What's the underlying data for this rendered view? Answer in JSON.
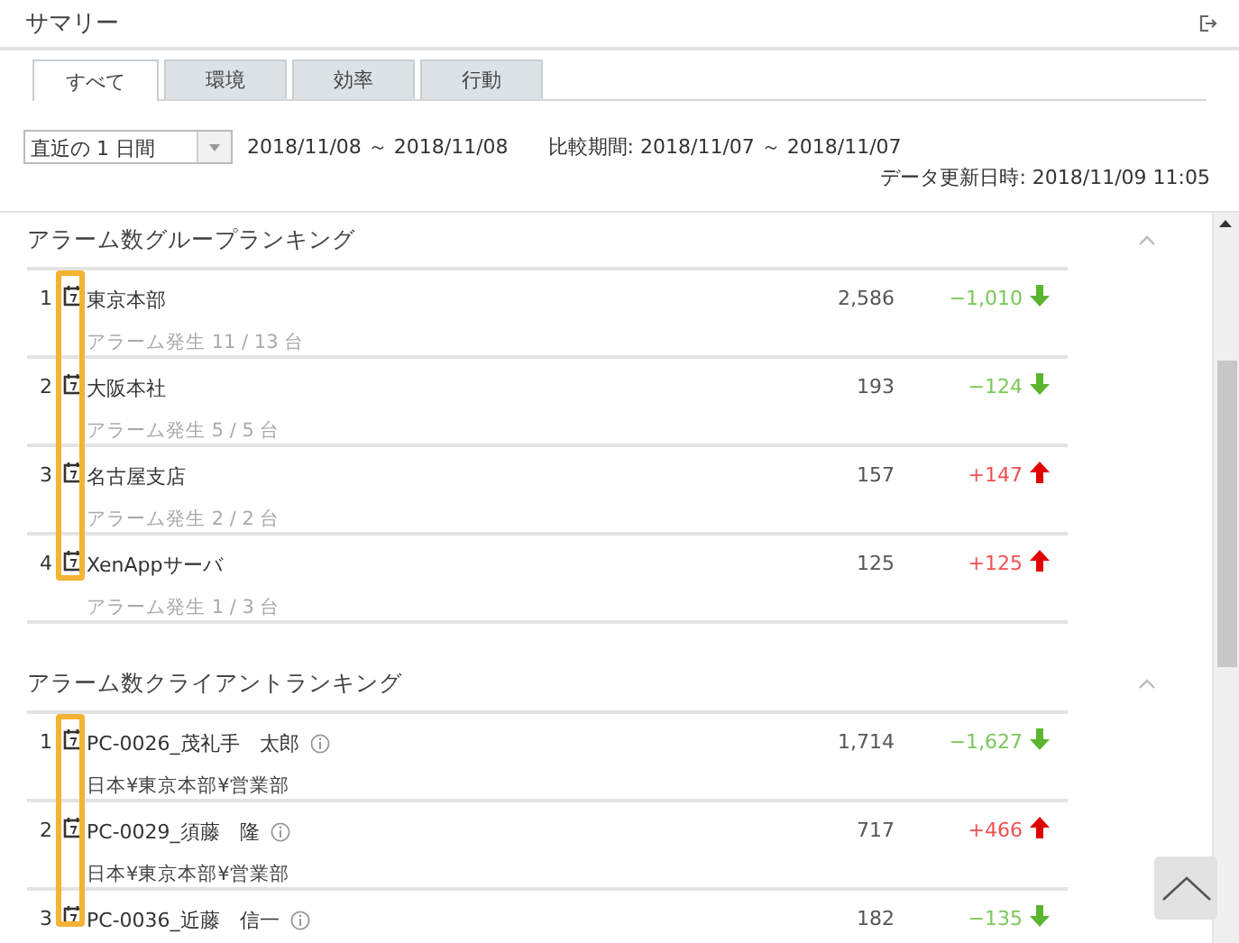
{
  "header": {
    "title": "サマリー"
  },
  "tabs": [
    {
      "label": "すべて",
      "selected": true
    },
    {
      "label": "環境",
      "selected": false
    },
    {
      "label": "効率",
      "selected": false
    },
    {
      "label": "行動",
      "selected": false
    }
  ],
  "filter": {
    "period": "直近の 1 日間",
    "range": "2018/11/08 ～ 2018/11/08",
    "compare": "比較期間: 2018/11/07 ～ 2018/11/07",
    "updated": "データ更新日時: 2018/11/09 11:05"
  },
  "sections": [
    {
      "title": "アラーム数グループランキング",
      "kind": "group",
      "icon_column_highlighted": true,
      "rows": [
        {
          "rank": "1",
          "name": "東京本部",
          "sub": "アラーム発生 11 / 13 台",
          "count": "2,586",
          "change": "−1,010",
          "rising": false
        },
        {
          "rank": "2",
          "name": "大阪本社",
          "sub": "アラーム発生 5 / 5 台",
          "count": "193",
          "change": "−124",
          "rising": false
        },
        {
          "rank": "3",
          "name": "名古屋支店",
          "sub": "アラーム発生 2 / 2 台",
          "count": "157",
          "change": "+147",
          "rising": true
        },
        {
          "rank": "4",
          "name": "XenAppサーバ",
          "sub": "アラーム発生 1 / 3 台",
          "count": "125",
          "change": "+125",
          "rising": true
        }
      ]
    },
    {
      "title": "アラーム数クライアントランキング",
      "kind": "client",
      "icon_column_highlighted": true,
      "rows": [
        {
          "rank": "1",
          "name": "PC-0026_茂礼手　太郎",
          "sub": "日本¥東京本部¥営業部",
          "count": "1,714",
          "change": "−1,627",
          "rising": false
        },
        {
          "rank": "2",
          "name": "PC-0029_須藤　隆",
          "sub": "日本¥東京本部¥営業部",
          "count": "717",
          "change": "+466",
          "rising": true
        },
        {
          "rank": "3",
          "name": "PC-0036_近藤　信一",
          "count": "182",
          "change": "−135",
          "rising": false
        }
      ]
    }
  ]
}
